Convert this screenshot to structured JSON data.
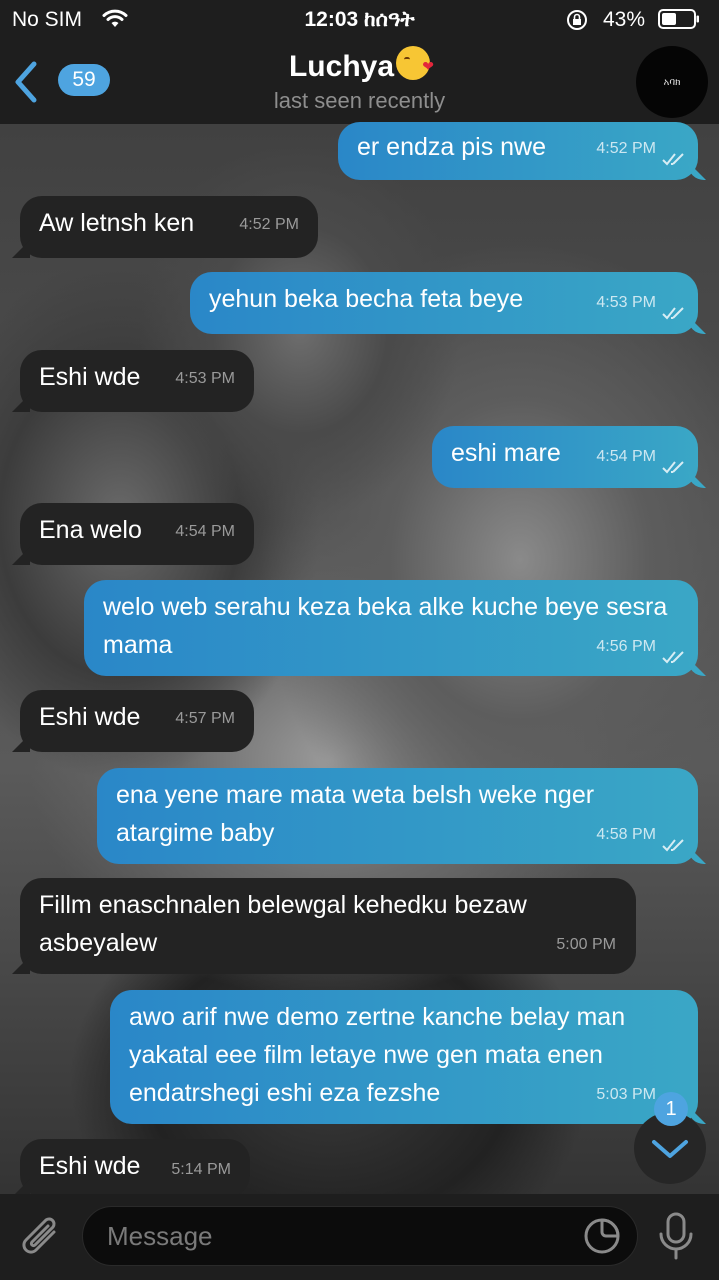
{
  "status_bar": {
    "carrier": "No SIM",
    "time": "12:03 ከሰዓት",
    "battery": "43%",
    "icons": [
      "wifi-icon",
      "orientation-lock-icon",
      "battery-icon"
    ]
  },
  "header": {
    "back_count": "59",
    "title": "Luchya",
    "title_emoji": "kissing-face-emoji",
    "subtitle": "last seen recently",
    "avatar_text": "አባክ"
  },
  "messages": [
    {
      "dir": "out",
      "text": "er endza pis nwe",
      "time": "4:52 PM",
      "read": true
    },
    {
      "dir": "in",
      "text": "Aw letnsh ken",
      "time": "4:52 PM"
    },
    {
      "dir": "out",
      "text": "yehun beka becha feta beye",
      "time": "4:53 PM",
      "read": true
    },
    {
      "dir": "in",
      "text": "Eshi wde",
      "time": "4:53 PM"
    },
    {
      "dir": "out",
      "text": "eshi mare",
      "time": "4:54 PM",
      "read": true
    },
    {
      "dir": "in",
      "text": "Ena welo",
      "time": "4:54 PM"
    },
    {
      "dir": "out",
      "text": "welo web serahu keza beka alke kuche beye sesra mama",
      "time": "4:56 PM",
      "read": true
    },
    {
      "dir": "in",
      "text": "Eshi wde",
      "time": "4:57 PM"
    },
    {
      "dir": "out",
      "text": "ena yene mare mata weta belsh weke nger atargime baby",
      "time": "4:58 PM",
      "read": true
    },
    {
      "dir": "in",
      "text": "Fillm enaschnalen belewgal kehedku bezaw asbeyalew",
      "time": "5:00 PM"
    },
    {
      "dir": "out",
      "text": "awo arif nwe demo zertne kanche belay man yakatal eee film letaye nwe gen mata enen endatrshegi eshi eza fezshe",
      "time": "5:03 PM",
      "read": true
    },
    {
      "dir": "in",
      "text": "Eshi wde",
      "time": "5:14 PM"
    }
  ],
  "scroll_down": {
    "unread": "1"
  },
  "composer": {
    "placeholder": "Message"
  },
  "colors": {
    "outgoing": "#3a9bc4",
    "incoming": "#232323",
    "accent": "#4ea4e0"
  }
}
